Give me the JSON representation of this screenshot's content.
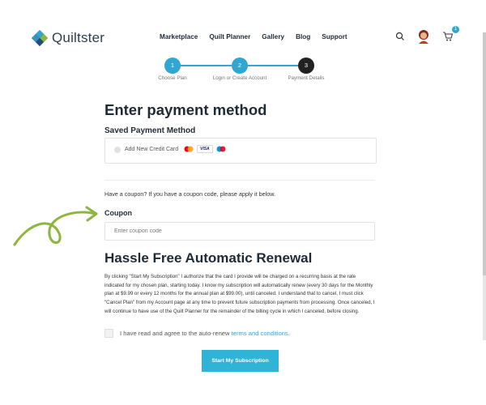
{
  "brand": {
    "name": "Quiltster"
  },
  "nav": {
    "items": [
      "Marketplace",
      "Quilt Planner",
      "Gallery",
      "Blog",
      "Support"
    ]
  },
  "header": {
    "cart_count": "1"
  },
  "steps": [
    {
      "number": "1",
      "label": "Choose Plan",
      "state": "done"
    },
    {
      "number": "2",
      "label": "Login or Create Account",
      "state": "done"
    },
    {
      "number": "3",
      "label": "Payment Details",
      "state": "current"
    }
  ],
  "payment": {
    "title": "Enter payment method",
    "saved_title": "Saved Payment Method",
    "add_card_label": "Add New Credit Card",
    "visa_label": "VISA"
  },
  "coupon": {
    "question": "Have a coupon? If you have a coupon code, please apply it below.",
    "title": "Coupon",
    "placeholder": "Enter coupon code"
  },
  "renewal": {
    "title": "Hassle Free Automatic Renewal",
    "body": "By clicking \"Start My Subscription\" I authorize that the card I provide will be charged on a recurring basis at the rate indicated for my chosen plan, starting today. I know my subscription will automatically renew (every 30 days for the Monthly plan at $9.99 or every 12 months for the annual plan at $99.00), until canceled. I understand that to cancel, I must click \"Cancel Plan\" from my Account page at any time to prevent future subscription payments from processing. Once canceled, I will continue to have use of the Quilt Planner for the remainder of the billing cycle in which I canceled, before closing.",
    "agree_text": "I have read and agree to the auto-renew",
    "agree_link": "terms and conditions",
    "agree_suffix": "."
  },
  "cta": {
    "label": "Start My Subscription"
  },
  "colors": {
    "accent": "#2fa7d0",
    "arrow": "#8db63c"
  }
}
